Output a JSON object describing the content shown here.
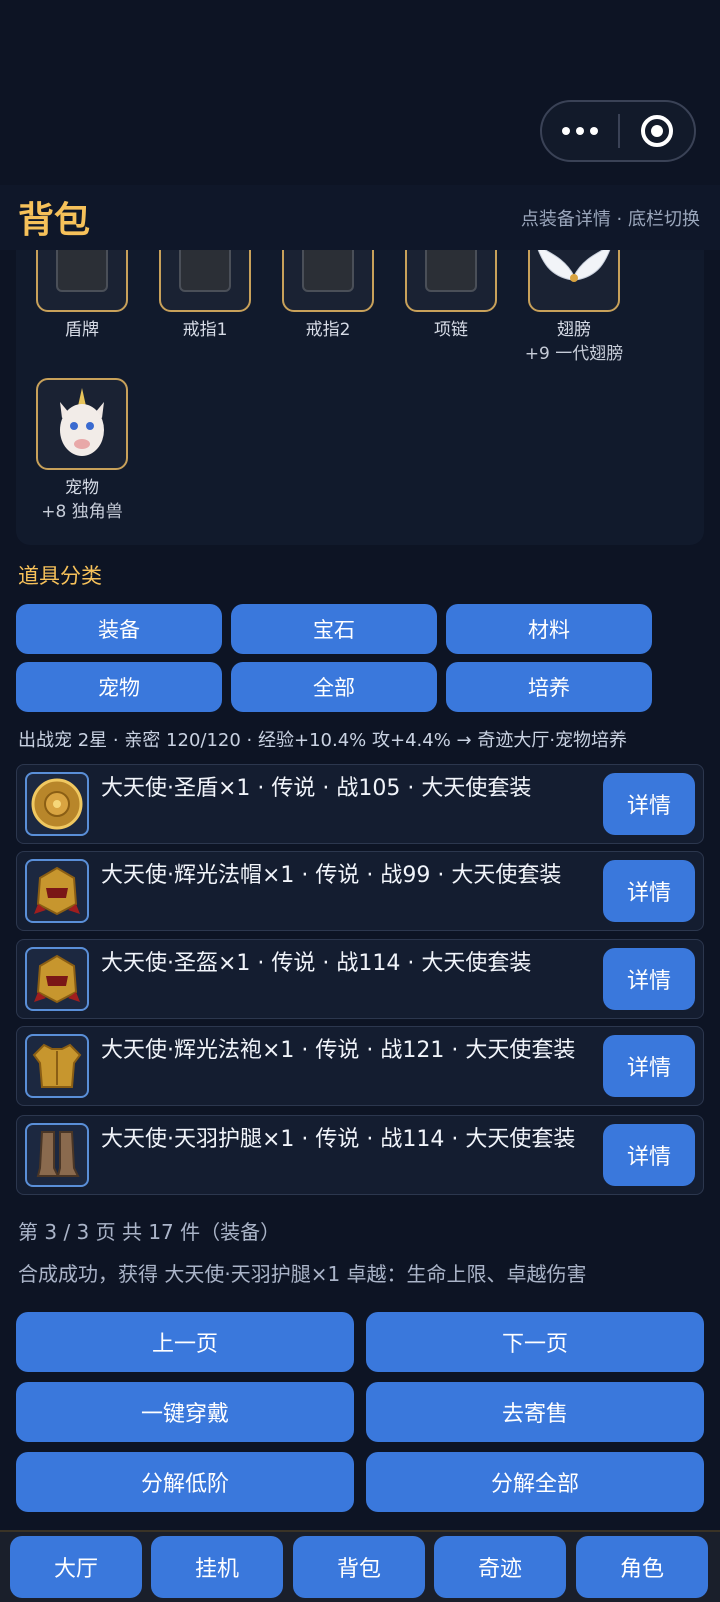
{
  "header": {
    "title": "背包",
    "hint": "点装备详情 · 底栏切换"
  },
  "equip_slots": [
    {
      "name": "盾牌",
      "sub": ""
    },
    {
      "name": "戒指1",
      "sub": ""
    },
    {
      "name": "戒指2",
      "sub": ""
    },
    {
      "name": "项链",
      "sub": ""
    },
    {
      "name": "翅膀",
      "sub": "+9 一代翅膀"
    },
    {
      "name": "宠物",
      "sub": "+8 独角兽"
    }
  ],
  "categories": {
    "title": "道具分类",
    "buttons": [
      "装备",
      "宝石",
      "材料",
      "宠物",
      "全部",
      "培养"
    ]
  },
  "pet_line": "出战宠 2星 · 亲密 120/120 · 经验+10.4% 攻+4.4%   → 奇迹大厅·宠物培养",
  "items": [
    {
      "text": "大天使·圣盾×1 · 传说 · 战105 · 大天使套装",
      "detail": "详情",
      "icon": "shield-icon"
    },
    {
      "text": "大天使·辉光法帽×1 · 传说 · 战99 · 大天使套装",
      "detail": "详情",
      "icon": "helmet-icon"
    },
    {
      "text": "大天使·圣盔×1 · 传说 · 战114 · 大天使套装",
      "detail": "详情",
      "icon": "helmet-icon"
    },
    {
      "text": "大天使·辉光法袍×1 · 传说 · 战121 · 大天使套装",
      "detail": "详情",
      "icon": "armor-icon"
    },
    {
      "text": "大天使·天羽护腿×1 · 传说 · 战114 · 大天使套装",
      "detail": "详情",
      "icon": "boots-icon"
    }
  ],
  "pagination": {
    "info": "第 3 / 3 页   共 17 件（装备）"
  },
  "message": "合成成功，获得 大天使·天羽护腿×1   卓越：生命上限、卓越伤害",
  "actions": {
    "prev": "上一页",
    "next": "下一页",
    "equip_all": "一键穿戴",
    "sell": "去寄售",
    "decompose_low": "分解低阶",
    "decompose_all": "分解全部"
  },
  "tabs": [
    "大厅",
    "挂机",
    "背包",
    "奇迹",
    "角色"
  ],
  "colors": {
    "accent": "#3a78dc",
    "gold": "#f6c15a",
    "background": "#0d1424"
  }
}
